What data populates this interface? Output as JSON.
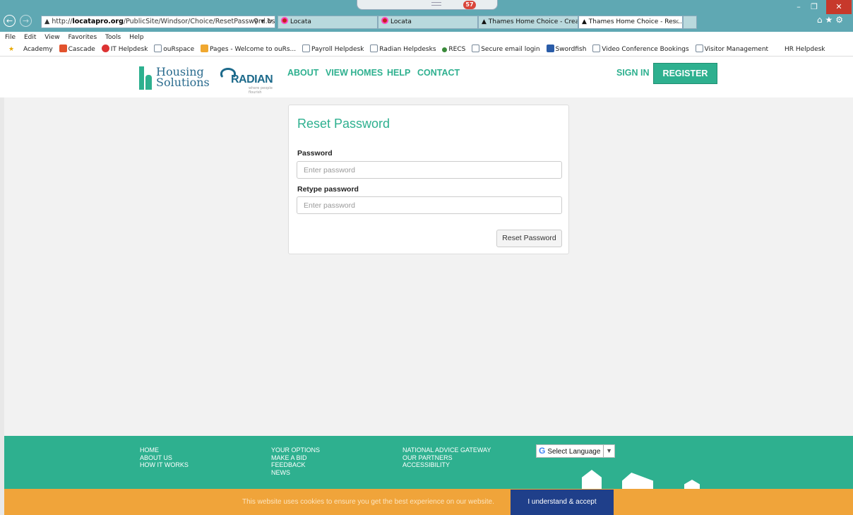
{
  "browser": {
    "address": {
      "prefix": "http://",
      "domain": "locatapro.org",
      "path": "/PublicSite/Windsor/Choice/ResetPassword.aspx?gui"
    },
    "notification_count": "57",
    "tabs": [
      {
        "label": "Locata"
      },
      {
        "label": "Locata"
      },
      {
        "label": "Thames Home Choice - Create..."
      },
      {
        "label": "Thames Home Choice - Res..."
      }
    ],
    "menu": [
      "File",
      "Edit",
      "View",
      "Favorites",
      "Tools",
      "Help"
    ],
    "favorites": [
      "Academy",
      "Cascade",
      "IT Helpdesk",
      "ouRspace",
      "Pages - Welcome to ouRs...",
      "Payroll Helpdesk",
      "Radian Helpdesks",
      "RECS",
      "Secure email login",
      "Swordfish",
      "Video Conference Bookings",
      "Visitor Management",
      "HR Helpdesk"
    ]
  },
  "site": {
    "logo_line1": "Housing",
    "logo_line2": "Solutions",
    "partner_logo": "RADIAN",
    "partner_tagline": "where people flourish",
    "nav": {
      "about": "ABOUT",
      "view_homes": "VIEW HOMES",
      "help": "HELP",
      "contact": "CONTACT"
    },
    "sign_in": "SIGN IN",
    "register": "REGISTER"
  },
  "form": {
    "title": "Reset Password",
    "password_label": "Password",
    "password_placeholder": "Enter password",
    "retype_label": "Retype password",
    "retype_placeholder": "Enter password",
    "submit": "Reset Password"
  },
  "footer": {
    "col1": [
      "HOME",
      "ABOUT US",
      "HOW IT WORKS"
    ],
    "col2": [
      "YOUR OPTIONS",
      "MAKE A BID",
      "FEEDBACK",
      "NEWS"
    ],
    "col3": [
      "NATIONAL ADVICE GATEWAY",
      "OUR PARTNERS",
      "ACCESSIBILITY"
    ],
    "language": "Select Language"
  },
  "cookie": {
    "text": "This website uses cookies to ensure you get the best experience on our website.",
    "accept": "I understand & accept"
  },
  "colors": {
    "accent": "#2eb08f",
    "cookie_bar": "#f0a43a",
    "accept_button": "#1f3f8a",
    "chrome": "#5fa8b3"
  }
}
